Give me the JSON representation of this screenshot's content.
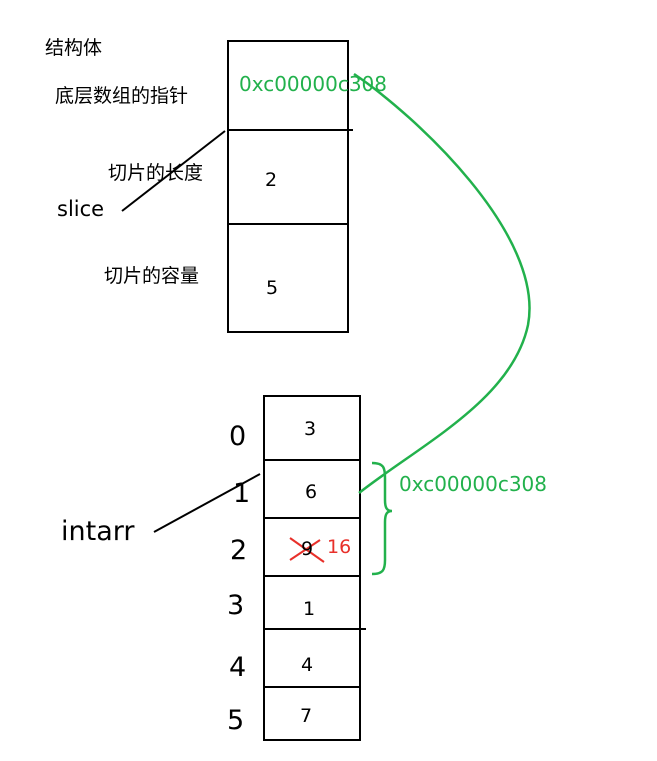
{
  "struct": {
    "title": "结构体",
    "fields": [
      {
        "label": "底层数组的指针",
        "value": "0xc00000c308"
      },
      {
        "label": "切片的长度",
        "value": "2"
      },
      {
        "label": "切片的容量",
        "value": "5"
      }
    ],
    "variable": "slice"
  },
  "array": {
    "variable": "intarr",
    "indices": [
      "0",
      "1",
      "2",
      "3",
      "4",
      "5"
    ],
    "values": [
      "3",
      "6",
      "9",
      "1",
      "4",
      "7"
    ],
    "modified_value": "16",
    "range_address": "0xc00000c308"
  },
  "colors": {
    "pointer": "#22b14c",
    "edit": "#e8302a",
    "ink": "#000000"
  }
}
